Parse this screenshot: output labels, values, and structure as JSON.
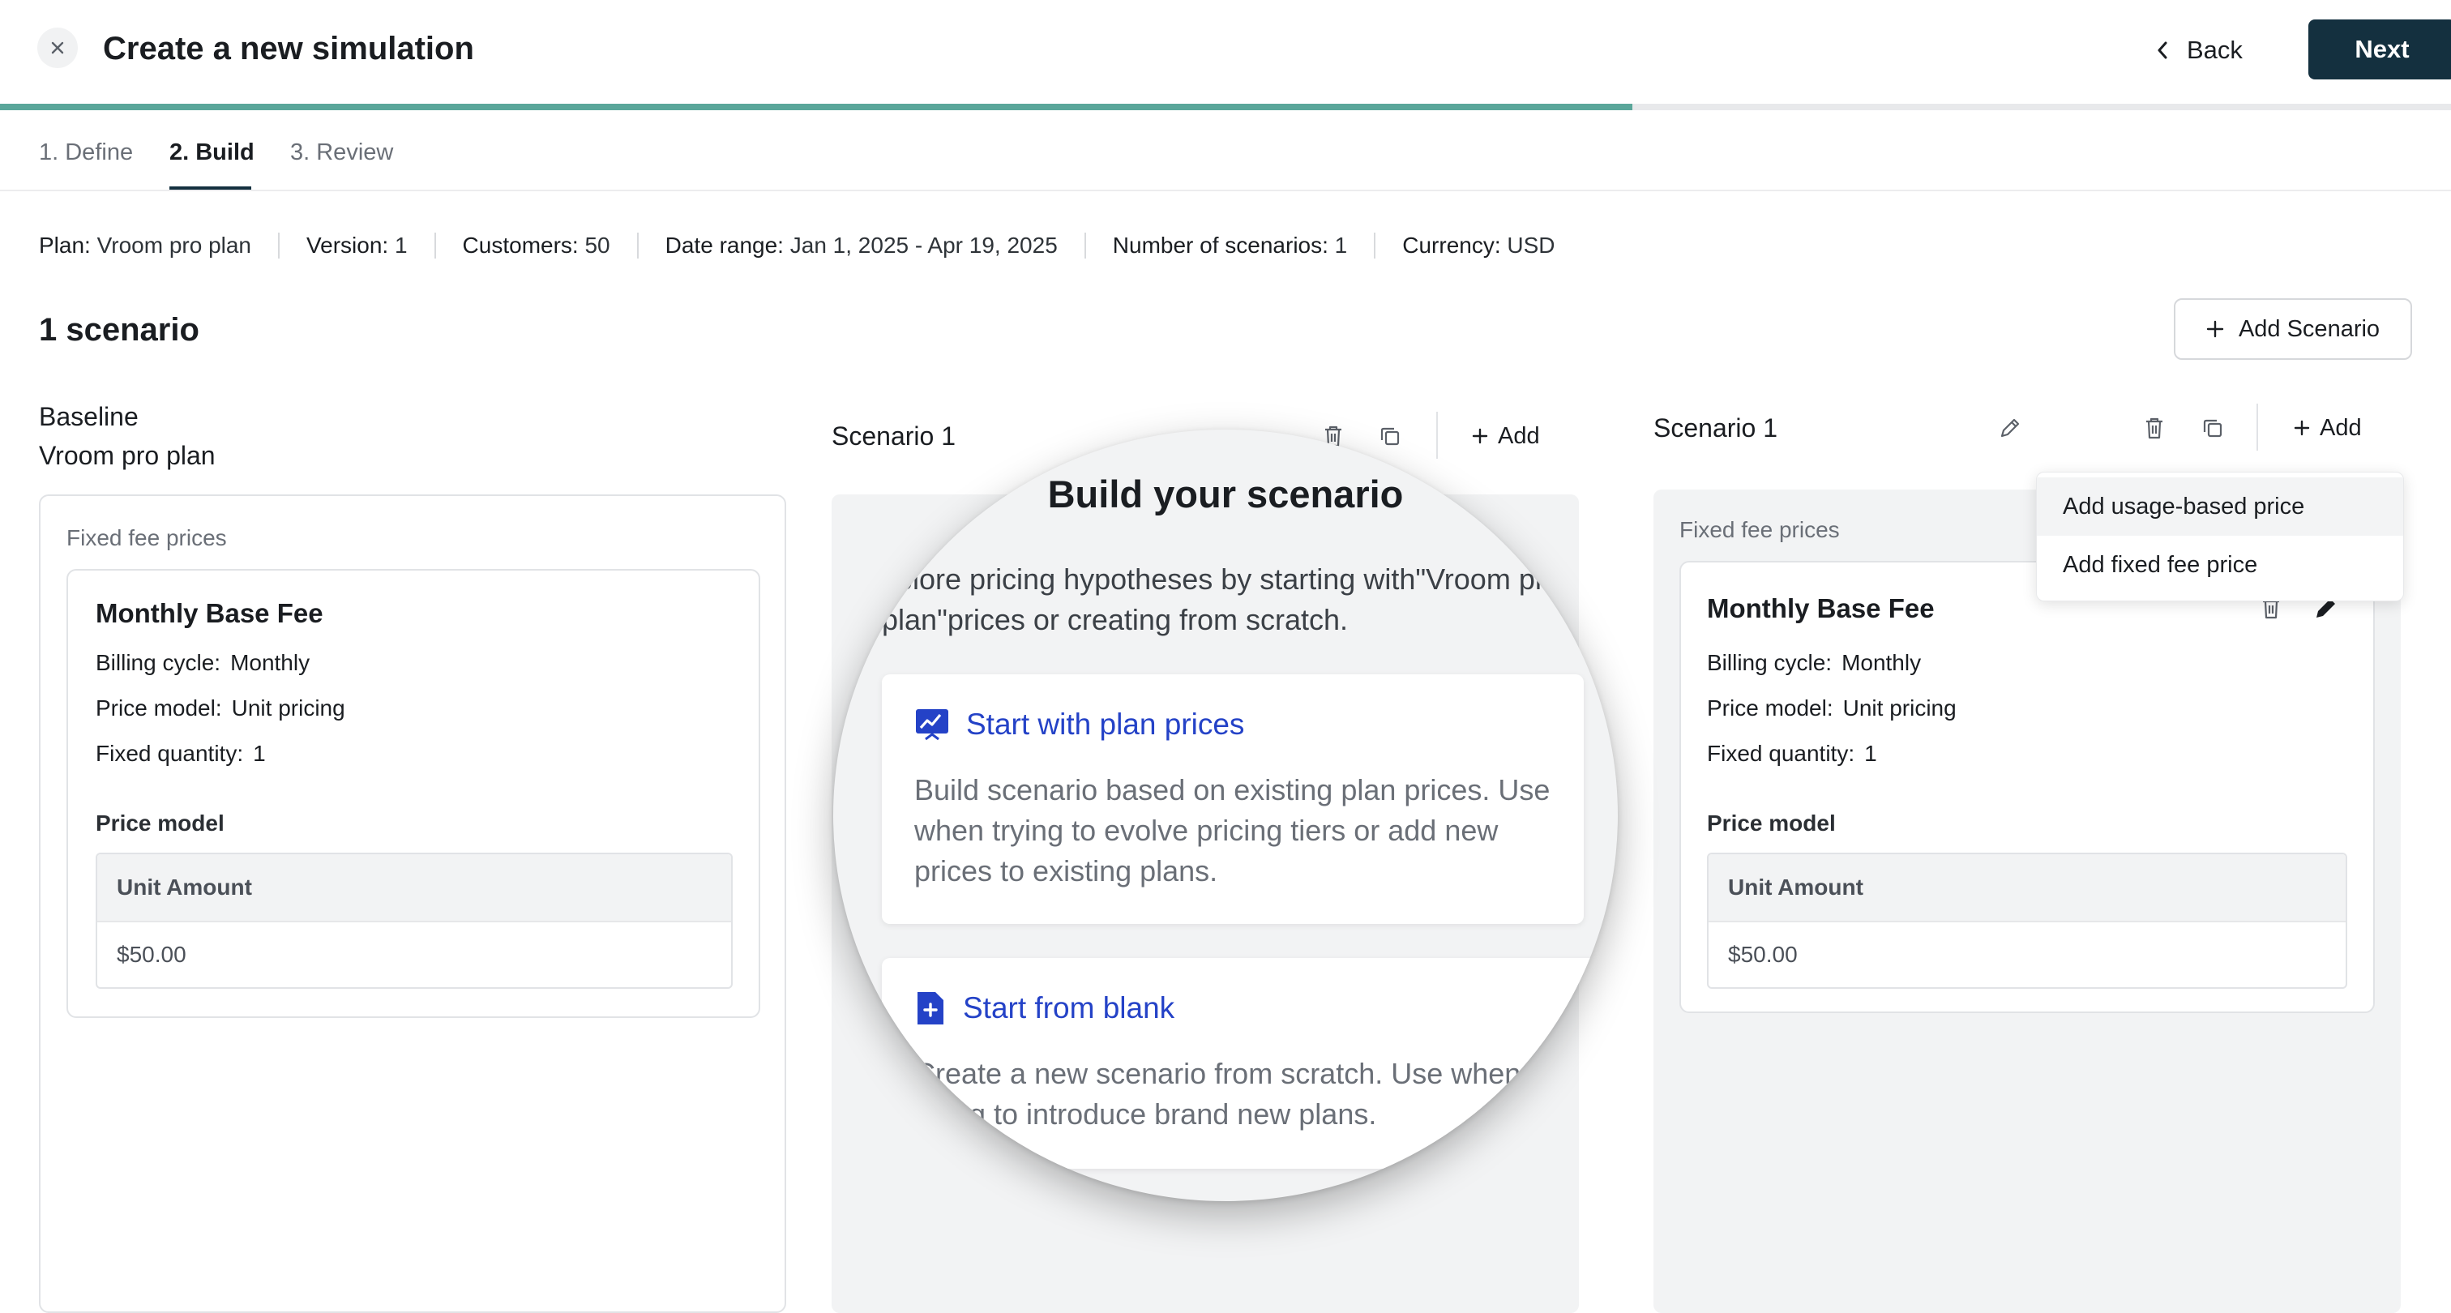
{
  "header": {
    "title": "Create a new simulation",
    "back_label": "Back",
    "next_label": "Next",
    "progress": 0.666
  },
  "tabs": [
    {
      "label": "1. Define"
    },
    {
      "label": "2. Build",
      "active": true
    },
    {
      "label": "3. Review"
    }
  ],
  "info": [
    {
      "label": "Plan:",
      "value": "Vroom pro plan"
    },
    {
      "label": "Version:",
      "value": "1"
    },
    {
      "label": "Customers:",
      "value": "50"
    },
    {
      "label": "Date range:",
      "value": "Jan 1, 2025 - Apr 19, 2025"
    },
    {
      "label": "Number of scenarios:",
      "value": "1"
    },
    {
      "label": "Currency:",
      "value": "USD"
    }
  ],
  "scenario_count": "1 scenario",
  "add_scenario_label": "Add Scenario",
  "baseline": {
    "heading": "Baseline",
    "plan_name": "Vroom pro plan",
    "section_label": "Fixed fee prices",
    "card": {
      "title": "Monthly Base Fee",
      "billing_label": "Billing cycle:",
      "billing_value": "Monthly",
      "model_label": "Price model:",
      "model_value": "Unit pricing",
      "qty_label": "Fixed quantity:",
      "qty_value": "1",
      "price_model_label": "Price model",
      "amount_header": "Unit Amount",
      "amount_value": "$50.00"
    }
  },
  "scenario_mid": {
    "name": "Scenario 1",
    "add_label": "Add"
  },
  "scenario_right": {
    "name": "Scenario 1",
    "add_label": "Add",
    "section_label": "Fixed fee prices",
    "card": {
      "title": "Monthly Base Fee",
      "billing_label": "Billing cycle:",
      "billing_value": "Monthly",
      "model_label": "Price model:",
      "model_value": "Unit pricing",
      "qty_label": "Fixed quantity:",
      "qty_value": "1",
      "price_model_label": "Price model",
      "amount_header": "Unit Amount",
      "amount_value": "$50.00"
    }
  },
  "dropdown": {
    "items": [
      "Add usage-based price",
      "Add fixed fee price"
    ]
  },
  "magnifier": {
    "title": "Build your scenario",
    "description": "xplore pricing hypotheses by starting with\"Vroom pro plan\"prices or creating from scratch.",
    "option1": {
      "title": "Start with plan prices",
      "description": "Build scenario based on existing plan prices. Use when trying to evolve pricing tiers or add new prices to existing plans."
    },
    "option2": {
      "title": "Start from blank",
      "description": "Create a new scenario from scratch. Use when trying to introduce brand new plans."
    }
  },
  "colors": {
    "accent_dark": "#14303f",
    "progress": "#5aa69a",
    "link_blue": "#2442c7"
  }
}
